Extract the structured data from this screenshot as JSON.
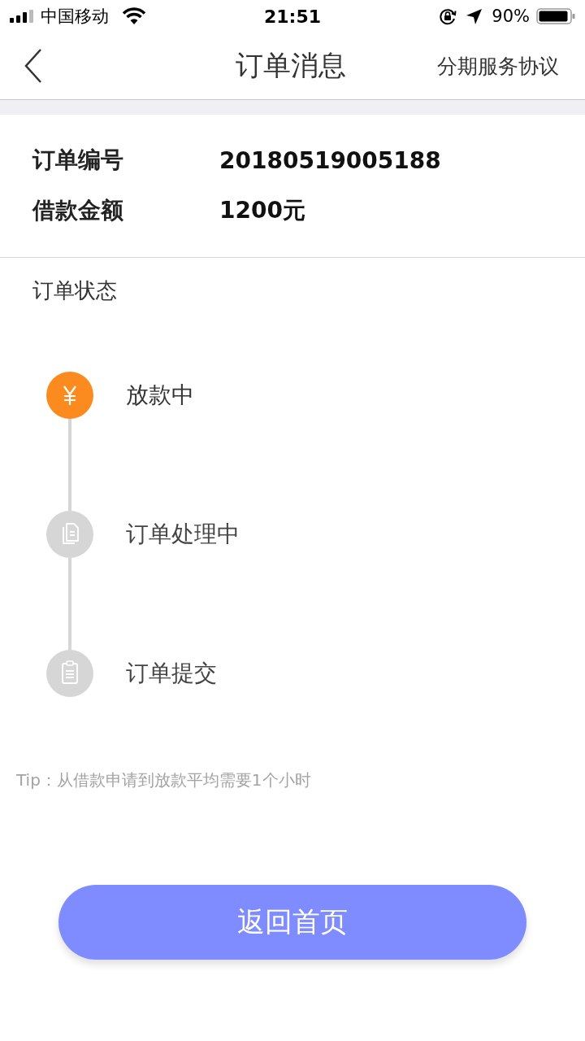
{
  "status_bar": {
    "carrier": "中国移动",
    "time": "21:51",
    "battery": "90%"
  },
  "nav": {
    "title": "订单消息",
    "action": "分期服务协议"
  },
  "order_info": [
    {
      "label": "订单编号",
      "value": "20180519005188"
    },
    {
      "label": "借款金额",
      "value": "1200元"
    }
  ],
  "status_section": {
    "title": "订单状态",
    "steps": [
      {
        "label": "放款中",
        "kind": "money",
        "active": true
      },
      {
        "label": "订单处理中",
        "kind": "documents",
        "active": false
      },
      {
        "label": "订单提交",
        "kind": "clipboard",
        "active": false
      }
    ]
  },
  "tip": "Tip：从借款申请到放款平均需要1个小时",
  "button": "返回首页"
}
